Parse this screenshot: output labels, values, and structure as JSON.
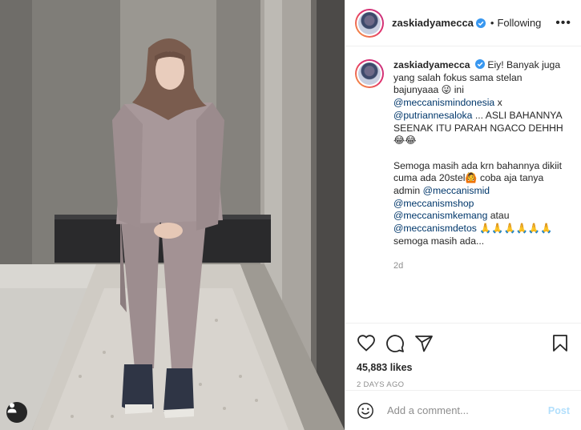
{
  "post": {
    "username": "zaskiadyamecca",
    "follow_separator": "•",
    "follow_status": "Following",
    "more_label": "•••",
    "caption": {
      "username": "zaskiadyamecca",
      "line1": "Eiy! Banyak juga yang salah fokus sama stelan bajunyaaa 😜 ini",
      "mention1": "@meccanismindonesia",
      "x_text": " x",
      "mention2": "@putriannesaloka",
      "line2": " ... ASLI BAHANNYA SEENAK ITU PARAH NGACO DEHHH 😂😂",
      "line3": "Semoga masih ada krn bahannya dikiit cuma ada 20stel🙆 coba aja tanya admin",
      "mention3": "@meccanismid",
      "mention4": "@meccanismshop",
      "mention5": "@meccanismkemang",
      "atau": " atau",
      "mention6": "@meccanismdetos",
      "line4": " 🙏🙏🙏🙏🙏🙏 semoga masih ada..."
    },
    "caption_time": "2d",
    "likes": "45,883 likes",
    "posted_ago": "2 DAYS AGO",
    "comment_placeholder": "Add a comment...",
    "post_label": "Post"
  },
  "icons": {
    "verified": "verified-badge-icon",
    "like": "heart-icon",
    "comment": "comment-icon",
    "share": "paper-plane-icon",
    "save": "bookmark-icon",
    "emoji": "smiley-icon",
    "tag": "user-tag-icon"
  },
  "colors": {
    "verified_blue": "#3897f0",
    "link": "#00376b",
    "post_disabled": "#b2dffc",
    "muted": "#8e8e8e"
  }
}
